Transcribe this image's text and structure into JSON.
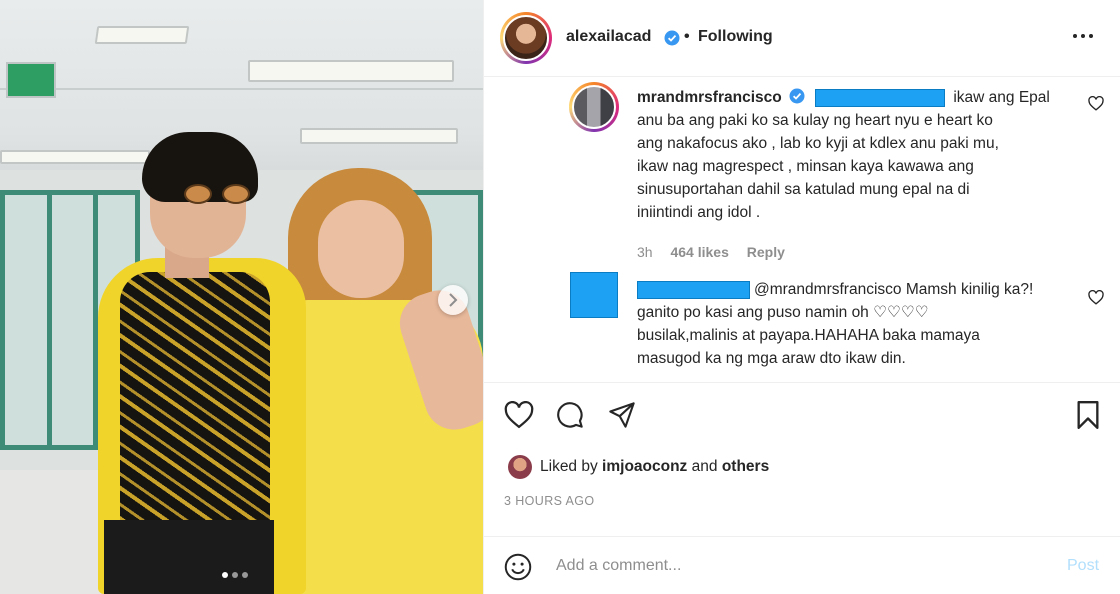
{
  "header": {
    "username": "alexailacad",
    "separator": "•",
    "follow_status": "Following"
  },
  "comments": [
    {
      "username": "mrandmrsfrancisco",
      "text_lines": [
        "ikaw ang Epal",
        "anu ba ang paki ko sa kulay ng heart nyu e heart ko",
        "ang nakafocus ako , lab ko kyji at kdlex anu paki mu,",
        "ikaw nag magrespect , minsan kaya kawawa ang",
        "sinusuportahan dahil sa katulad mung epal na di",
        "iniintindi ang idol ."
      ],
      "time": "3h",
      "likes": "464 likes",
      "reply_label": "Reply"
    },
    {
      "mention": "@mrandmrsfrancisco",
      "text_lines": [
        "Mamsh kinilig ka?!",
        "ganito po kasi ang puso namin oh ♡♡♡♡",
        "busilak,malinis at payapa.HAHAHA baka mamaya",
        "masugod ka ng mga araw dto ikaw din."
      ]
    }
  ],
  "liked_by": {
    "prefix": "Liked by",
    "user": "imjoaoconz",
    "joiner": "and",
    "others": "others"
  },
  "timestamp": "3 HOURS AGO",
  "add_comment": {
    "placeholder": "Add a comment...",
    "post_label": "Post"
  },
  "colors": {
    "verified_blue": "#3897f0",
    "redaction_blue": "#1da1f2",
    "post_disabled": "#b2dffc",
    "muted_text": "#8e8e8e"
  },
  "icons": [
    "heart-icon",
    "comment-icon",
    "share-icon",
    "bookmark-icon",
    "emoji-icon",
    "more-options-icon",
    "verified-badge-icon",
    "chevron-right-icon"
  ]
}
